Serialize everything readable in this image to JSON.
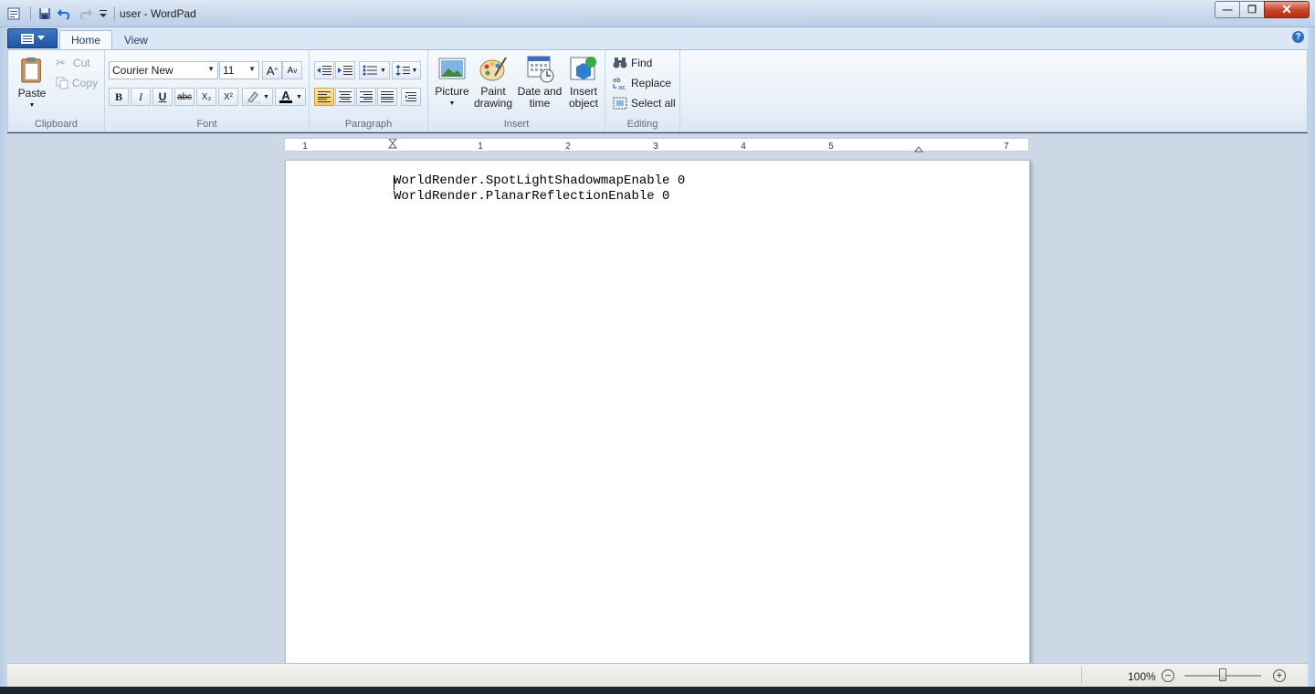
{
  "window": {
    "title": "user - WordPad",
    "controls": {
      "minimize": "—",
      "maximize": "❐",
      "close": "✕"
    }
  },
  "quick_access": {
    "save_icon": "save-icon",
    "undo_icon": "undo-icon",
    "redo_icon": "redo-icon",
    "customize_icon": "chevron-down-icon"
  },
  "tabs": [
    {
      "label": "Home",
      "selected": true
    },
    {
      "label": "View",
      "selected": false
    }
  ],
  "help": "?",
  "ribbon": {
    "clipboard": {
      "label": "Clipboard",
      "paste": "Paste",
      "cut": "Cut",
      "copy": "Copy"
    },
    "font": {
      "label": "Font",
      "family": "Courier New",
      "size": "11",
      "bold": "B",
      "italic": "I",
      "underline": "U",
      "strike": "abc",
      "subscript": "X₂",
      "superscript": "X²",
      "color_a": "A",
      "grow": "A",
      "shrink": "A"
    },
    "paragraph": {
      "label": "Paragraph",
      "alignment": "left"
    },
    "insert": {
      "label": "Insert",
      "picture": "Picture",
      "paint_1": "Paint",
      "paint_2": "drawing",
      "date_1": "Date and",
      "date_2": "time",
      "object_1": "Insert",
      "object_2": "object"
    },
    "editing": {
      "label": "Editing",
      "find": "Find",
      "replace": "Replace",
      "select_all": "Select all"
    }
  },
  "ruler": {
    "labels": [
      "1",
      "1",
      "2",
      "3",
      "4",
      "5",
      "7"
    ]
  },
  "document": {
    "lines": [
      "WorldRender.SpotLightShadowmapEnable 0",
      "WorldRender.PlanarReflectionEnable 0"
    ]
  },
  "status": {
    "zoom": "100%",
    "zoom_out": "−",
    "zoom_in": "+",
    "zoom_fraction": 0.5
  },
  "colors": {
    "accent": "#1e54a4",
    "font_color_swatch": "#000000",
    "highlight_swatch": "#ffffff"
  }
}
